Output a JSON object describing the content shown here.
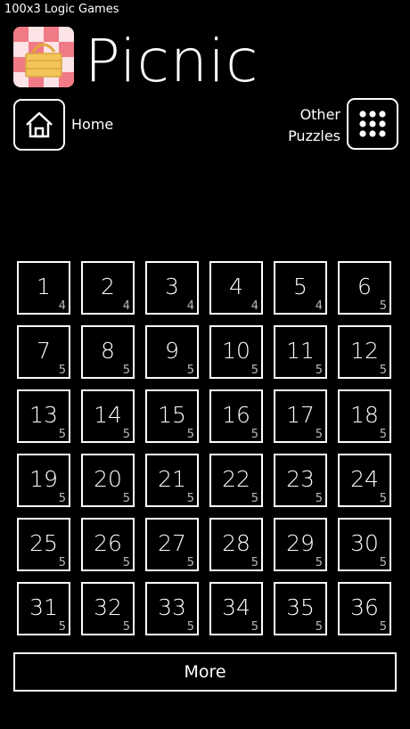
{
  "status_text": "100x3 Logic Games",
  "app_title": "Picnic",
  "nav": {
    "home_label": "Home",
    "other_label_1": "Other",
    "other_label_2": "Puzzles"
  },
  "levels": [
    {
      "n": "1",
      "s": "4"
    },
    {
      "n": "2",
      "s": "4"
    },
    {
      "n": "3",
      "s": "4"
    },
    {
      "n": "4",
      "s": "4"
    },
    {
      "n": "5",
      "s": "4"
    },
    {
      "n": "6",
      "s": "5"
    },
    {
      "n": "7",
      "s": "5"
    },
    {
      "n": "8",
      "s": "5"
    },
    {
      "n": "9",
      "s": "5"
    },
    {
      "n": "10",
      "s": "5"
    },
    {
      "n": "11",
      "s": "5"
    },
    {
      "n": "12",
      "s": "5"
    },
    {
      "n": "13",
      "s": "5"
    },
    {
      "n": "14",
      "s": "5"
    },
    {
      "n": "15",
      "s": "5"
    },
    {
      "n": "16",
      "s": "5"
    },
    {
      "n": "17",
      "s": "5"
    },
    {
      "n": "18",
      "s": "5"
    },
    {
      "n": "19",
      "s": "5"
    },
    {
      "n": "20",
      "s": "5"
    },
    {
      "n": "21",
      "s": "5"
    },
    {
      "n": "22",
      "s": "5"
    },
    {
      "n": "23",
      "s": "5"
    },
    {
      "n": "24",
      "s": "5"
    },
    {
      "n": "25",
      "s": "5"
    },
    {
      "n": "26",
      "s": "5"
    },
    {
      "n": "27",
      "s": "5"
    },
    {
      "n": "28",
      "s": "5"
    },
    {
      "n": "29",
      "s": "5"
    },
    {
      "n": "30",
      "s": "5"
    },
    {
      "n": "31",
      "s": "5"
    },
    {
      "n": "32",
      "s": "5"
    },
    {
      "n": "33",
      "s": "5"
    },
    {
      "n": "34",
      "s": "5"
    },
    {
      "n": "35",
      "s": "5"
    },
    {
      "n": "36",
      "s": "5"
    }
  ],
  "more_label": "More",
  "colors": {
    "logo_pink": "#f07a86",
    "logo_light": "#fbe3e6",
    "basket": "#f2c45a"
  },
  "icons": {
    "home": "home-icon",
    "grid": "grid-icon",
    "logo": "picnic-basket-icon"
  }
}
